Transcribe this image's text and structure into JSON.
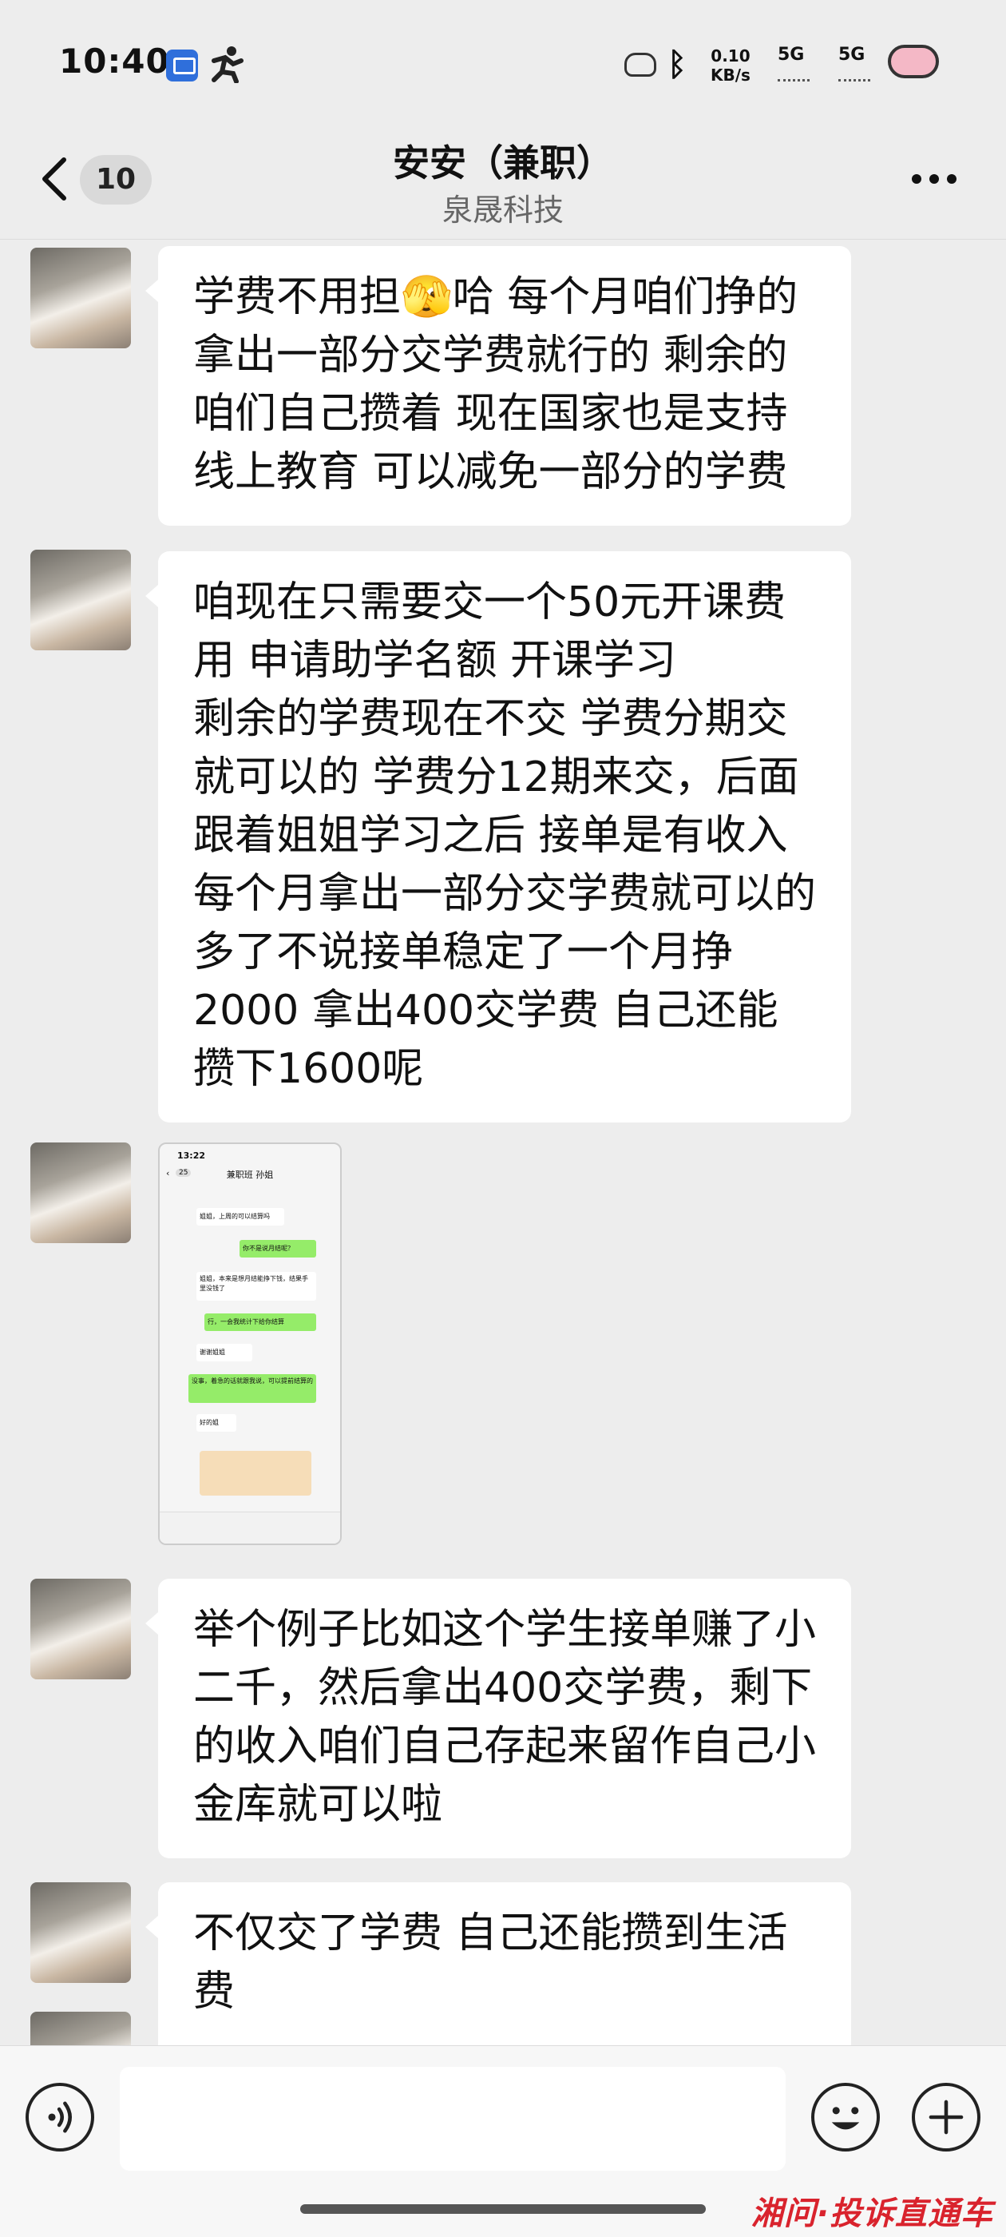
{
  "status_bar": {
    "time": "10:40",
    "net_speed_value": "0.10",
    "net_speed_unit": "KB/s",
    "signal1": "5G",
    "signal2": "5G"
  },
  "header": {
    "unread_count": "10",
    "title": "安安（兼职）",
    "subtitle": "泉晟科技"
  },
  "messages": [
    {
      "text": "学费不用担🫣哈 每个月咱们挣的拿出一部分交学费就行的 剩余的咱们自己攒着 现在国家也是支持线上教育 可以减免一部分的学费"
    },
    {
      "text": "咱现在只需要交一个50元开课费用 申请助学名额 开课学习\n剩余的学费现在不交 学费分期交就可以的 学费分12期来交，后面跟着姐姐学习之后 接单是有收入 每个月拿出一部分交学费就可以的 多了不说接单稳定了一个月挣2000 拿出400交学费 自己还能攒下1600呢"
    },
    {
      "text": "举个例子比如这个学生接单赚了小二千，然后拿出400交学费，剩下的收入咱们自己存起来留作自己小金库就可以啦"
    },
    {
      "text": "不仅交了学费 自己还能攒到生活费"
    }
  ],
  "screenshot_msg": {
    "time": "13:22",
    "title": "兼职班 孙姐",
    "badge": "25",
    "rows": [
      "姐姐，上周的可以结算吗",
      "你不是说月结呢？",
      "姐姐，本来是想月结能挣下钱，结果手里没钱了",
      "行，一会我统计下给你结算",
      "谢谢姐姐",
      "没事，着急的话就跟我说，可以提前结算的",
      "好的姐"
    ]
  },
  "input_bar": {
    "placeholder": ""
  },
  "watermark": "湘问·投诉直通车"
}
